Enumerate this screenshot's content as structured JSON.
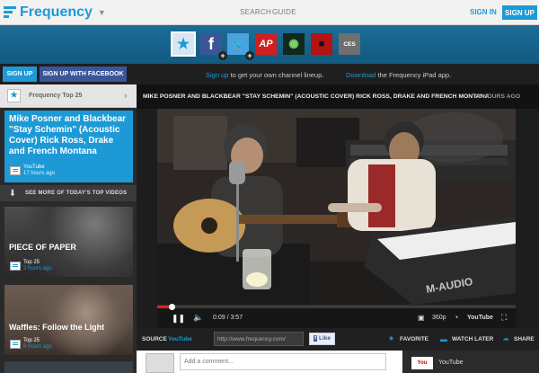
{
  "header": {
    "app_name": "Frequency",
    "nav": [
      "SEARCH",
      "GUIDE"
    ],
    "sign_in": "SIGN IN",
    "sign_up": "SIGN UP"
  },
  "channels": [
    {
      "name": "frequency-top-25",
      "label": "★"
    },
    {
      "name": "facebook",
      "label": "f"
    },
    {
      "name": "twitter",
      "label": "🐦"
    },
    {
      "name": "ap",
      "label": "AP"
    },
    {
      "name": "creature",
      "label": "✺"
    },
    {
      "name": "news-channel",
      "label": "■"
    },
    {
      "name": "ces",
      "label": "CES"
    }
  ],
  "action_bar": {
    "signup": "SIGN UP",
    "signup_fb": "SIGN UP WITH FACEBOOK",
    "promo1_link": "Sign up",
    "promo1_text": " to get your own channel lineup.",
    "promo2_link": "Download",
    "promo2_text": " the Frequency iPad app."
  },
  "sidebar": {
    "title": "Frequency Top 25",
    "featured": {
      "title": "Mike Posner and Blackbear \"Stay Schemin\" (Acoustic Cover) Rick Ross, Drake and French Montana",
      "source": "YouTube",
      "time": "17 hours ago"
    },
    "see_more": "SEE MORE OF TODAY'S TOP VIDEOS",
    "items": [
      {
        "title": "PIECE OF PAPER",
        "source": "Top 25",
        "time": "2 hours ago"
      },
      {
        "title": "Waffles: Follow the Light",
        "source": "Top 25",
        "time": "6 hours ago"
      }
    ]
  },
  "player": {
    "title": "MIKE POSNER AND BLACKBEAR \"STAY SCHEMIN\" (ACOUSTIC COVER) RICK ROSS, DRAKE AND FRENCH MONTANA",
    "time_ago": "17 HOURS AGO",
    "current_time": "0:09 / 3:57",
    "quality": "360p",
    "youtube_mark": "YouTube",
    "keyboard_brand": "M-AUDIO",
    "progress": 0.04
  },
  "info": {
    "source_label": "SOURCE",
    "source_value": "YouTube",
    "url": "http://www.frequency.com/",
    "like": "Like",
    "favorite": "FAVORITE",
    "watch_later": "WATCH LATER",
    "share": "SHARE"
  },
  "comments": {
    "placeholder": "Add a comment...",
    "panel_source": "YouTube"
  },
  "colors": {
    "accent": "#1d9ad6",
    "channel_bar": "#1c6d97",
    "facebook": "#3a5598"
  }
}
